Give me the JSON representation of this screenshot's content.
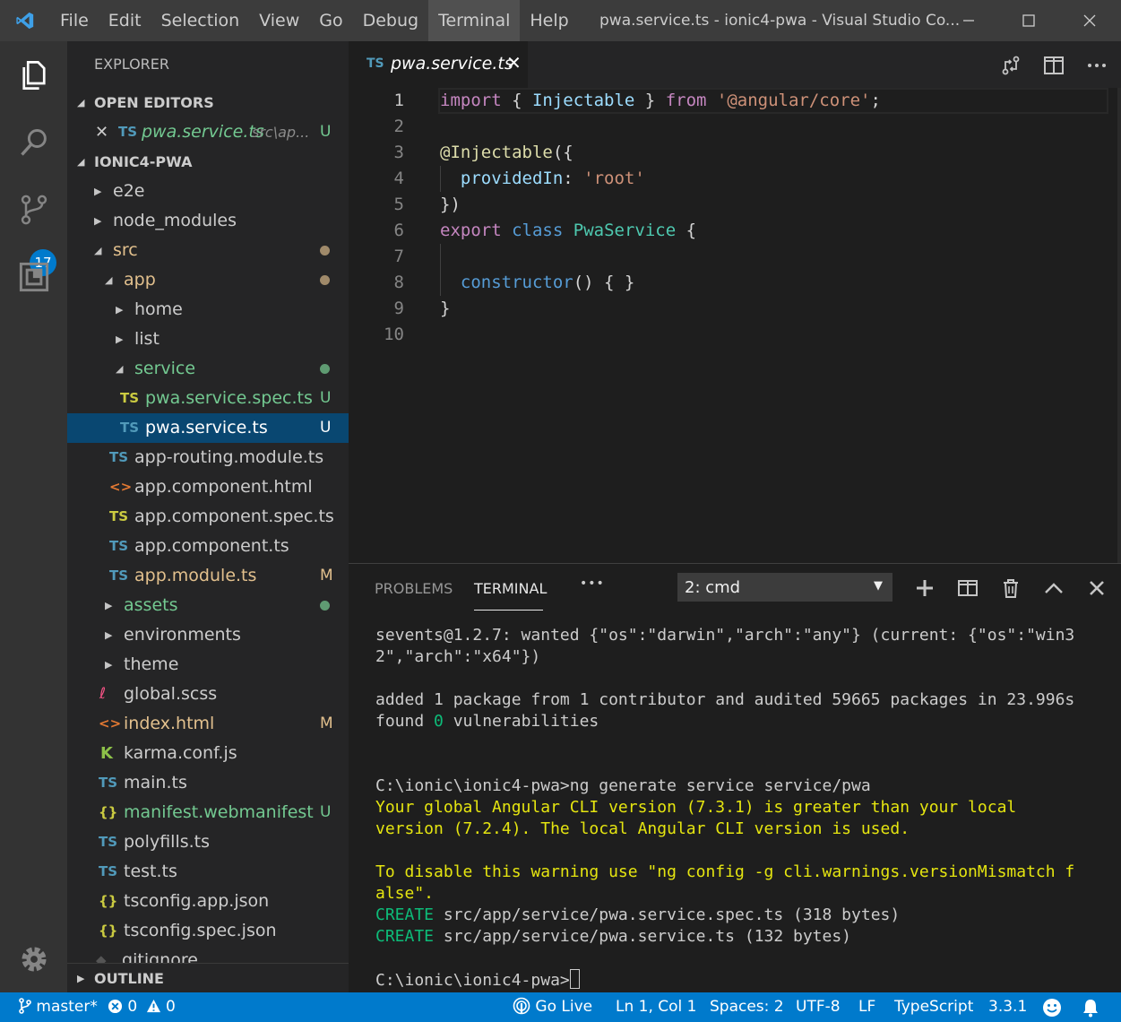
{
  "titlebar": {
    "menu": [
      "File",
      "Edit",
      "Selection",
      "View",
      "Go",
      "Debug",
      "Terminal",
      "Help"
    ],
    "active_menu": "Terminal",
    "window_title": "pwa.service.ts - ionic4-pwa - Visual Studio Co..."
  },
  "activity": {
    "scm_badge": "17"
  },
  "sidebar": {
    "title": "EXPLORER",
    "open_editors": {
      "label": "OPEN EDITORS",
      "item": {
        "icon": "TS",
        "name": "pwa.service.ts",
        "path": "src\\ap...",
        "status": "U"
      }
    },
    "project_label": "IONIC4-PWA",
    "tree": [
      {
        "name": "e2e",
        "status": ""
      },
      {
        "name": "node_modules",
        "status": ""
      },
      {
        "name": "src",
        "status": ""
      },
      {
        "name": "app",
        "status": ""
      },
      {
        "name": "home",
        "status": ""
      },
      {
        "name": "list",
        "status": ""
      },
      {
        "name": "service",
        "status": ""
      },
      {
        "icon": "TS",
        "name": "pwa.service.spec.ts",
        "status": "U"
      },
      {
        "icon": "TS",
        "name": "pwa.service.ts",
        "status": "U"
      },
      {
        "icon": "TS",
        "name": "app-routing.module.ts",
        "status": ""
      },
      {
        "icon": "<>",
        "name": "app.component.html",
        "status": ""
      },
      {
        "icon": "TS",
        "name": "app.component.spec.ts",
        "status": ""
      },
      {
        "icon": "TS",
        "name": "app.component.ts",
        "status": ""
      },
      {
        "icon": "TS",
        "name": "app.module.ts",
        "status": "M"
      },
      {
        "name": "assets",
        "status": ""
      },
      {
        "name": "environments",
        "status": ""
      },
      {
        "name": "theme",
        "status": ""
      },
      {
        "name": "global.scss",
        "status": ""
      },
      {
        "icon": "<>",
        "name": "index.html",
        "status": "M"
      },
      {
        "icon": "K",
        "name": "karma.conf.js",
        "status": ""
      },
      {
        "icon": "TS",
        "name": "main.ts",
        "status": ""
      },
      {
        "icon": "{}",
        "name": "manifest.webmanifest",
        "status": "U"
      },
      {
        "icon": "TS",
        "name": "polyfills.ts",
        "status": ""
      },
      {
        "icon": "TS",
        "name": "test.ts",
        "status": ""
      },
      {
        "icon": "{}",
        "name": "tsconfig.app.json",
        "status": ""
      },
      {
        "icon": "{}",
        "name": "tsconfig.spec.json",
        "status": ""
      },
      {
        "name": ".gitignore",
        "status": ""
      }
    ],
    "outline_label": "OUTLINE"
  },
  "editor": {
    "tab": {
      "icon": "TS",
      "name": "pwa.service.ts"
    },
    "line_numbers": [
      "1",
      "2",
      "3",
      "4",
      "5",
      "6",
      "7",
      "8",
      "9",
      "10"
    ],
    "code": {
      "l1": {
        "import": "import",
        "open": " { ",
        "injectable": "Injectable",
        "close": " } ",
        "from": "from",
        "sp": " ",
        "module": "'@angular/core'",
        "semi": ";"
      },
      "l3": {
        "decorator": "@Injectable",
        "rest": "({"
      },
      "l4": {
        "indent": "  ",
        "prop": "providedIn",
        "colon": ": ",
        "val": "'root'"
      },
      "l5": {
        "text": "})"
      },
      "l6": {
        "export": "export",
        "sp1": " ",
        "class": "class",
        "sp2": " ",
        "name": "PwaService",
        "brace": " {"
      },
      "l8": {
        "indent": "  ",
        "ctor": "constructor",
        "rest": "() { }"
      },
      "l9": {
        "text": "}"
      }
    }
  },
  "panel": {
    "tabs": [
      "PROBLEMS",
      "TERMINAL"
    ],
    "more": "•••",
    "terminal_select": "2: cmd",
    "lines": {
      "t1": "sevents@1.2.7: wanted {\"os\":\"darwin\",\"arch\":\"any\"} (current: {\"os\":\"win3",
      "t2": "2\",\"arch\":\"x64\"})",
      "t3": "added 1 package from 1 contributor and audited 59665 packages in 23.996s",
      "t4a": "found ",
      "t4b": "0",
      "t4c": " vulnerabilities",
      "t5": "C:\\ionic\\ionic4-pwa>ng generate service service/pwa",
      "t6": "Your global Angular CLI version (7.3.1) is greater than your local",
      "t7": "version (7.2.4). The local Angular CLI version is used.",
      "t8": "To disable this warning use \"ng config -g cli.warnings.versionMismatch f",
      "t9": "alse\".",
      "t10a": "CREATE",
      "t10b": " src/app/service/pwa.service.spec.ts (318 bytes)",
      "t11a": "CREATE",
      "t11b": " src/app/service/pwa.service.ts (132 bytes)",
      "t12": "C:\\ionic\\ionic4-pwa>"
    }
  },
  "statusbar": {
    "branch": "master*",
    "errors": "0",
    "warnings": "0",
    "golive": "Go Live",
    "position": "Ln 1, Col 1",
    "spaces": "Spaces: 2",
    "encoding": "UTF-8",
    "eol": "LF",
    "language": "TypeScript",
    "version": "3.3.1"
  },
  "colors": {
    "accent": "#007acc",
    "selection": "#094771",
    "git_untracked": "#73c991",
    "git_modified": "#e2c08d"
  }
}
